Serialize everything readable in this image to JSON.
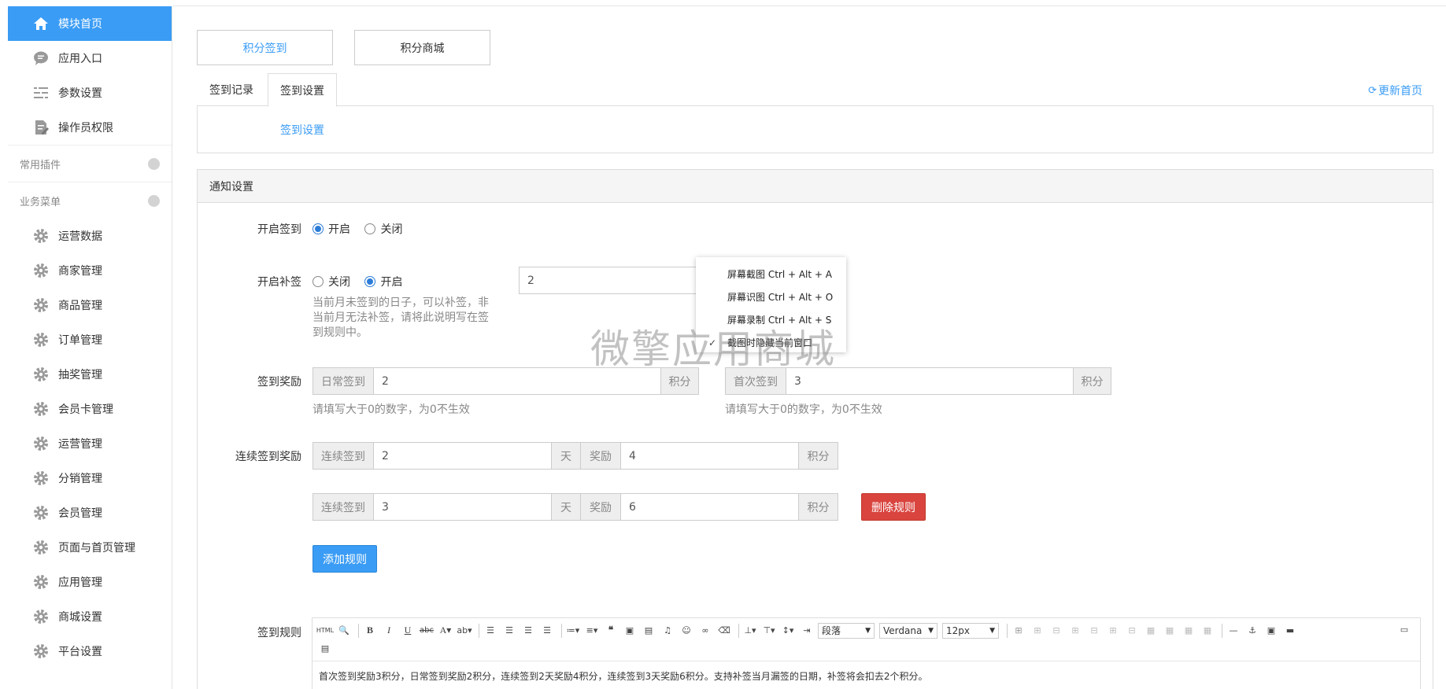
{
  "sidebar": {
    "top_items": [
      {
        "label": "模块首页",
        "icon": "home-icon"
      },
      {
        "label": "应用入口",
        "icon": "chat-icon"
      },
      {
        "label": "参数设置",
        "icon": "list-settings-icon"
      },
      {
        "label": "操作员权限",
        "icon": "document-edit-icon"
      }
    ],
    "sections": [
      {
        "label": "常用插件"
      },
      {
        "label": "业务菜单"
      }
    ],
    "menu_items": [
      {
        "label": "运营数据"
      },
      {
        "label": "商家管理"
      },
      {
        "label": "商品管理"
      },
      {
        "label": "订单管理"
      },
      {
        "label": "抽奖管理"
      },
      {
        "label": "会员卡管理"
      },
      {
        "label": "运营管理"
      },
      {
        "label": "分销管理"
      },
      {
        "label": "会员管理"
      },
      {
        "label": "页面与首页管理"
      },
      {
        "label": "应用管理"
      },
      {
        "label": "商城设置"
      },
      {
        "label": "平台设置"
      }
    ]
  },
  "modules": [
    "积分签到",
    "积分商城"
  ],
  "tabs": [
    "签到记录",
    "签到设置"
  ],
  "refresh_label": "更新首页",
  "sub_link": "签到设置",
  "panel": {
    "title": "通知设置",
    "enable_checkin": {
      "label": "开启签到",
      "options": [
        "开启",
        "关闭"
      ],
      "selected": "开启"
    },
    "enable_makeup": {
      "label": "开启补签",
      "options": [
        "关闭",
        "开启"
      ],
      "selected": "开启",
      "value": "2",
      "help": [
        "当前月未签到的日子，可以补签，非",
        "当前月无法补签，请将此说明写在签",
        "到规则中。"
      ]
    },
    "reward": {
      "label": "签到奖励",
      "daily": {
        "addon": "日常签到",
        "value": "2",
        "unit": "积分"
      },
      "first": {
        "addon": "首次签到",
        "value": "3",
        "unit": "积分"
      },
      "help": "请填写大于0的数字，为0不生效"
    },
    "continuous": {
      "label": "连续签到奖励",
      "rules": [
        {
          "addon": "连续签到",
          "days": "2",
          "day_unit": "天",
          "reward_addon": "奖励",
          "points": "4",
          "unit": "积分"
        },
        {
          "addon": "连续签到",
          "days": "3",
          "day_unit": "天",
          "reward_addon": "奖励",
          "points": "6",
          "unit": "积分",
          "delete_label": "删除规则"
        }
      ],
      "add_label": "添加规则"
    },
    "rules_label": "签到规则"
  },
  "editor": {
    "format_select": "段落",
    "font_select": "Verdana",
    "size_select": "12px",
    "content": "首次签到奖励3积分，日常签到奖励2积分，连续签到2天奖励4积分，连续签到3天奖励6积分。支持补签当月漏签的日期，补签将会扣去2个积分。"
  },
  "context_menu": {
    "items": [
      {
        "label": "屏幕截图 Ctrl + Alt + A",
        "checked": false
      },
      {
        "label": "屏幕识图 Ctrl + Alt + O",
        "checked": false
      },
      {
        "label": "屏幕录制 Ctrl + Alt + S",
        "checked": false
      },
      {
        "label": "截图时隐藏当前窗口",
        "checked": true
      }
    ]
  },
  "watermark": "微擎应用商城",
  "colors": {
    "accent": "#3a9cf5",
    "danger": "#d9443f"
  }
}
